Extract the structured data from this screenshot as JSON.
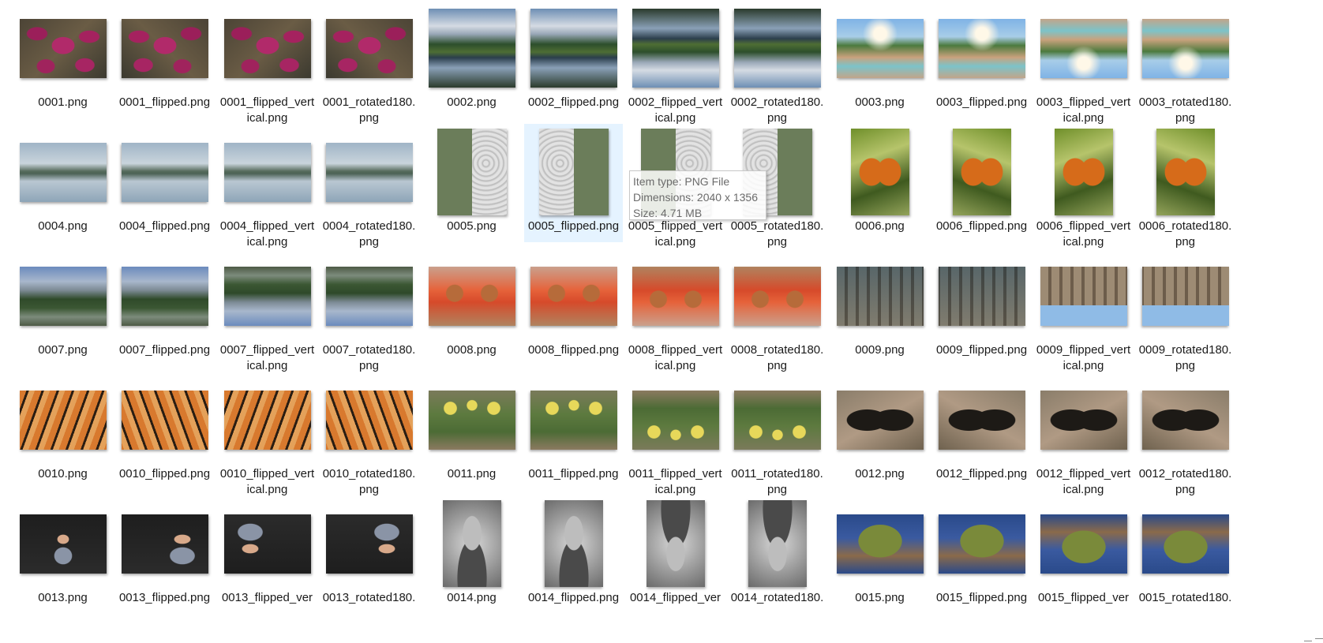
{
  "files": [
    {
      "name": "0001.png",
      "img": "img-starfish",
      "shape": "landscape"
    },
    {
      "name": "0001_flipped.png",
      "img": "img-starfish flip",
      "shape": "landscape"
    },
    {
      "name": "0001_flipped_vertical.png",
      "img": "img-starfish",
      "shape": "landscape"
    },
    {
      "name": "0001_rotated180.png",
      "img": "img-starfish flip",
      "shape": "landscape"
    },
    {
      "name": "0002.png",
      "img": "img-mountain",
      "shape": "square"
    },
    {
      "name": "0002_flipped.png",
      "img": "img-mountain flip",
      "shape": "square"
    },
    {
      "name": "0002_flipped_vertical.png",
      "img": "img-mountain-v",
      "shape": "square"
    },
    {
      "name": "0002_rotated180.png",
      "img": "img-mountain-v flip",
      "shape": "square"
    },
    {
      "name": "0003.png",
      "img": "img-palm",
      "shape": "landscape"
    },
    {
      "name": "0003_flipped.png",
      "img": "img-palm flip",
      "shape": "landscape"
    },
    {
      "name": "0003_flipped_vertical.png",
      "img": "img-palm-v",
      "shape": "landscape"
    },
    {
      "name": "0003_rotated180.png",
      "img": "img-palm-v flip",
      "shape": "landscape"
    },
    {
      "name": "0004.png",
      "img": "img-lake",
      "shape": "landscape"
    },
    {
      "name": "0004_flipped.png",
      "img": "img-lake flip",
      "shape": "landscape"
    },
    {
      "name": "0004_flipped_vertical.png",
      "img": "img-lake",
      "shape": "landscape"
    },
    {
      "name": "0004_rotated180.png",
      "img": "img-lake flip",
      "shape": "landscape"
    },
    {
      "name": "0005.png",
      "img": "img-stone-l",
      "shape": "portrait"
    },
    {
      "name": "0005_flipped.png",
      "img": "img-stone-r",
      "shape": "portrait"
    },
    {
      "name": "0005_flipped_vertical.png",
      "img": "img-stone-l",
      "shape": "portrait"
    },
    {
      "name": "0005_rotated180.png",
      "img": "img-stone-r",
      "shape": "portrait"
    },
    {
      "name": "0006.png",
      "img": "img-butterfly",
      "shape": "portrait-narrow"
    },
    {
      "name": "0006_flipped.png",
      "img": "img-butterfly flip",
      "shape": "portrait-narrow"
    },
    {
      "name": "0006_flipped_vertical.png",
      "img": "img-butterfly",
      "shape": "portrait-narrow"
    },
    {
      "name": "0006_rotated180.png",
      "img": "img-butterfly flip",
      "shape": "portrait-narrow"
    },
    {
      "name": "0007.png",
      "img": "img-yosemite",
      "shape": "landscape"
    },
    {
      "name": "0007_flipped.png",
      "img": "img-yosemite flip",
      "shape": "landscape"
    },
    {
      "name": "0007_flipped_vertical.png",
      "img": "img-yosemite-v",
      "shape": "landscape"
    },
    {
      "name": "0007_rotated180.png",
      "img": "img-yosemite-v flip",
      "shape": "landscape"
    },
    {
      "name": "0008.png",
      "img": "img-market",
      "shape": "landscape"
    },
    {
      "name": "0008_flipped.png",
      "img": "img-market flip",
      "shape": "landscape"
    },
    {
      "name": "0008_flipped_vertical.png",
      "img": "img-market-v",
      "shape": "landscape"
    },
    {
      "name": "0008_rotated180.png",
      "img": "img-market-v flip",
      "shape": "landscape"
    },
    {
      "name": "0009.png",
      "img": "img-aqueduct",
      "shape": "landscape"
    },
    {
      "name": "0009_flipped.png",
      "img": "img-aqueduct flip",
      "shape": "landscape"
    },
    {
      "name": "0009_flipped_vertical.png",
      "img": "img-aqueduct-v",
      "shape": "landscape"
    },
    {
      "name": "0009_rotated180.png",
      "img": "img-aqueduct-v flip",
      "shape": "landscape"
    },
    {
      "name": "0010.png",
      "img": "img-tiger",
      "shape": "landscape"
    },
    {
      "name": "0010_flipped.png",
      "img": "img-tiger flip",
      "shape": "landscape"
    },
    {
      "name": "0010_flipped_vertical.png",
      "img": "img-tiger",
      "shape": "landscape"
    },
    {
      "name": "0010_rotated180.png",
      "img": "img-tiger flip",
      "shape": "landscape"
    },
    {
      "name": "0011.png",
      "img": "img-cactus",
      "shape": "landscape"
    },
    {
      "name": "0011_flipped.png",
      "img": "img-cactus flip",
      "shape": "landscape"
    },
    {
      "name": "0011_flipped_vertical.png",
      "img": "img-cactus-v",
      "shape": "landscape"
    },
    {
      "name": "0011_rotated180.png",
      "img": "img-cactus-v flip",
      "shape": "landscape"
    },
    {
      "name": "0012.png",
      "img": "img-swallow",
      "shape": "landscape"
    },
    {
      "name": "0012_flipped.png",
      "img": "img-swallow flip",
      "shape": "landscape"
    },
    {
      "name": "0012_flipped_vertical.png",
      "img": "img-swallow",
      "shape": "landscape"
    },
    {
      "name": "0012_rotated180.png",
      "img": "img-swallow flip",
      "shape": "landscape"
    },
    {
      "name": "0013.png",
      "img": "img-boy",
      "shape": "landscape"
    },
    {
      "name": "0013_flipped.png",
      "img": "img-boy-r",
      "shape": "landscape"
    },
    {
      "name": "0013_flipped_ver",
      "img": "img-boy-v",
      "shape": "landscape"
    },
    {
      "name": "0013_rotated180.",
      "img": "img-boy-vr",
      "shape": "landscape"
    },
    {
      "name": "0014.png",
      "img": "img-oldman",
      "shape": "portrait-narrow"
    },
    {
      "name": "0014_flipped.png",
      "img": "img-oldman flip",
      "shape": "portrait-narrow"
    },
    {
      "name": "0014_flipped_ver",
      "img": "img-oldman-v",
      "shape": "portrait-narrow"
    },
    {
      "name": "0014_rotated180.",
      "img": "img-oldman-v flip",
      "shape": "portrait-narrow"
    },
    {
      "name": "0015.png",
      "img": "img-tree",
      "shape": "landscape"
    },
    {
      "name": "0015_flipped.png",
      "img": "img-tree flip",
      "shape": "landscape"
    },
    {
      "name": "0015_flipped_ver",
      "img": "img-tree-v",
      "shape": "landscape"
    },
    {
      "name": "0015_rotated180.",
      "img": "img-tree-v flip",
      "shape": "landscape"
    }
  ],
  "selected_file": "0005_flipped.png",
  "tooltip": {
    "item_type": "Item type: PNG File",
    "dimensions": "Dimensions: 2040 x 1356",
    "size": "Size: 4.71 MB"
  },
  "colors": {
    "selection": "#e5f3ff",
    "tooltip_text": "#6b6b6b",
    "label_text": "#1a1a1a"
  }
}
